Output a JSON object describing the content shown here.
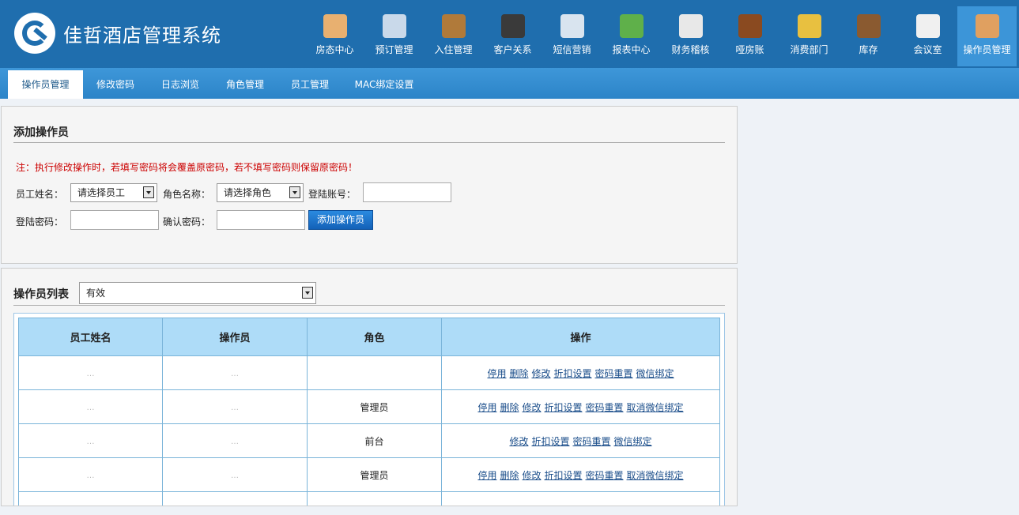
{
  "app": {
    "title": "佳哲酒店管理系统"
  },
  "topnav": [
    {
      "label": "房态中心",
      "icon": "house-icon",
      "color": "#e8b070"
    },
    {
      "label": "预订管理",
      "icon": "notepad-pencil-icon",
      "color": "#c9d9ea"
    },
    {
      "label": "入住管理",
      "icon": "door-key-icon",
      "color": "#b07a3a"
    },
    {
      "label": "客户关系",
      "icon": "people-icon",
      "color": "#3a3a3a"
    },
    {
      "label": "短信营销",
      "icon": "envelope-icon",
      "color": "#d9e4ef"
    },
    {
      "label": "报表中心",
      "icon": "bar-chart-icon",
      "color": "#5fb04a"
    },
    {
      "label": "财务稽核",
      "icon": "stamp-document-icon",
      "color": "#e8e8e8"
    },
    {
      "label": "哑房账",
      "icon": "ledger-book-icon",
      "color": "#8a4a20"
    },
    {
      "label": "消费部门",
      "icon": "coins-icon",
      "color": "#e8c040"
    },
    {
      "label": "库存",
      "icon": "warehouse-icon",
      "color": "#8a5a30"
    },
    {
      "label": "会议室",
      "icon": "meeting-sign-icon",
      "color": "#f0f0f0"
    },
    {
      "label": "操作员管理",
      "icon": "operator-person-icon",
      "color": "#e0a060",
      "active": true
    }
  ],
  "subnav": [
    "操作员管理",
    "修改密码",
    "日志浏览",
    "角色管理",
    "员工管理",
    "MAC绑定设置"
  ],
  "add_form": {
    "title": "添加操作员",
    "note": "注：执行修改操作时，若填写密码将会覆盖原密码，若不填写密码则保留原密码！",
    "employee_label": "员工姓名：",
    "employee_value": "请选择员工",
    "role_label": "角色名称：",
    "role_value": "请选择角色",
    "account_label": "登陆账号：",
    "password_label": "登陆密码：",
    "confirm_label": "确认密码：",
    "submit_label": "添加操作员"
  },
  "list": {
    "title": "操作员列表",
    "filter_value": "有效",
    "columns": [
      "员工姓名",
      "操作员",
      "角色",
      "操作"
    ],
    "rows": [
      {
        "name": "…",
        "operator": "…",
        "role": "",
        "actions": [
          "停用",
          "删除",
          "修改",
          "折扣设置",
          "密码重置",
          "微信绑定"
        ]
      },
      {
        "name": "…",
        "operator": "…",
        "role": "管理员",
        "actions": [
          "停用",
          "删除",
          "修改",
          "折扣设置",
          "密码重置",
          "取消微信绑定"
        ]
      },
      {
        "name": "…",
        "operator": "…",
        "role": "前台",
        "actions": [
          "修改",
          "折扣设置",
          "密码重置",
          "微信绑定"
        ]
      },
      {
        "name": "…",
        "operator": "…",
        "role": "管理员",
        "actions": [
          "停用",
          "删除",
          "修改",
          "折扣设置",
          "密码重置",
          "取消微信绑定"
        ]
      },
      {
        "name": "",
        "operator": "",
        "role": "",
        "actions": []
      }
    ]
  }
}
